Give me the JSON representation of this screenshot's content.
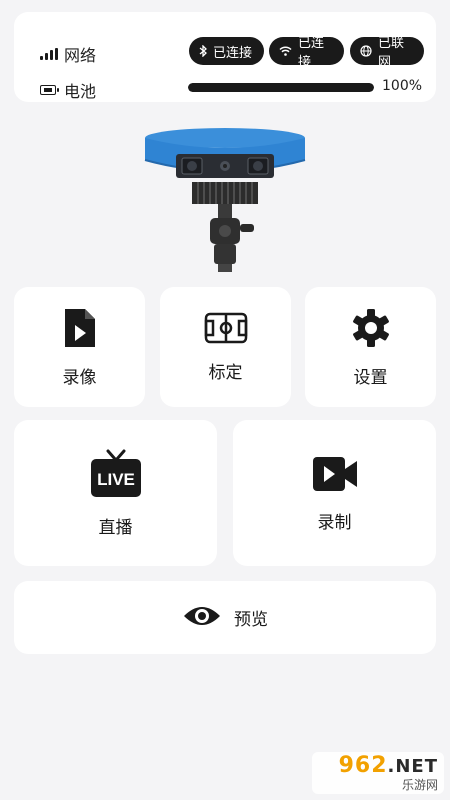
{
  "status": {
    "network_label": "网络",
    "battery_label": "电池",
    "bluetooth_status": "已连接",
    "wifi_status": "已连接",
    "internet_status": "已联网",
    "battery_percent_text": "100%",
    "battery_level": 1.0
  },
  "device": {
    "icon": "camera-device-image"
  },
  "tiles": {
    "record_video": "录像",
    "calibrate": "标定",
    "settings": "设置",
    "live": "直播",
    "live_badge": "LIVE",
    "recording": "录制",
    "preview": "预览"
  },
  "watermark": {
    "logo_num": "962",
    "logo_net": ".NET",
    "subtitle": "乐游网"
  },
  "colors": {
    "background": "#f4f4f6",
    "card": "#ffffff",
    "primary": "#1a1a1a",
    "device_blue": "#2f84d3"
  }
}
